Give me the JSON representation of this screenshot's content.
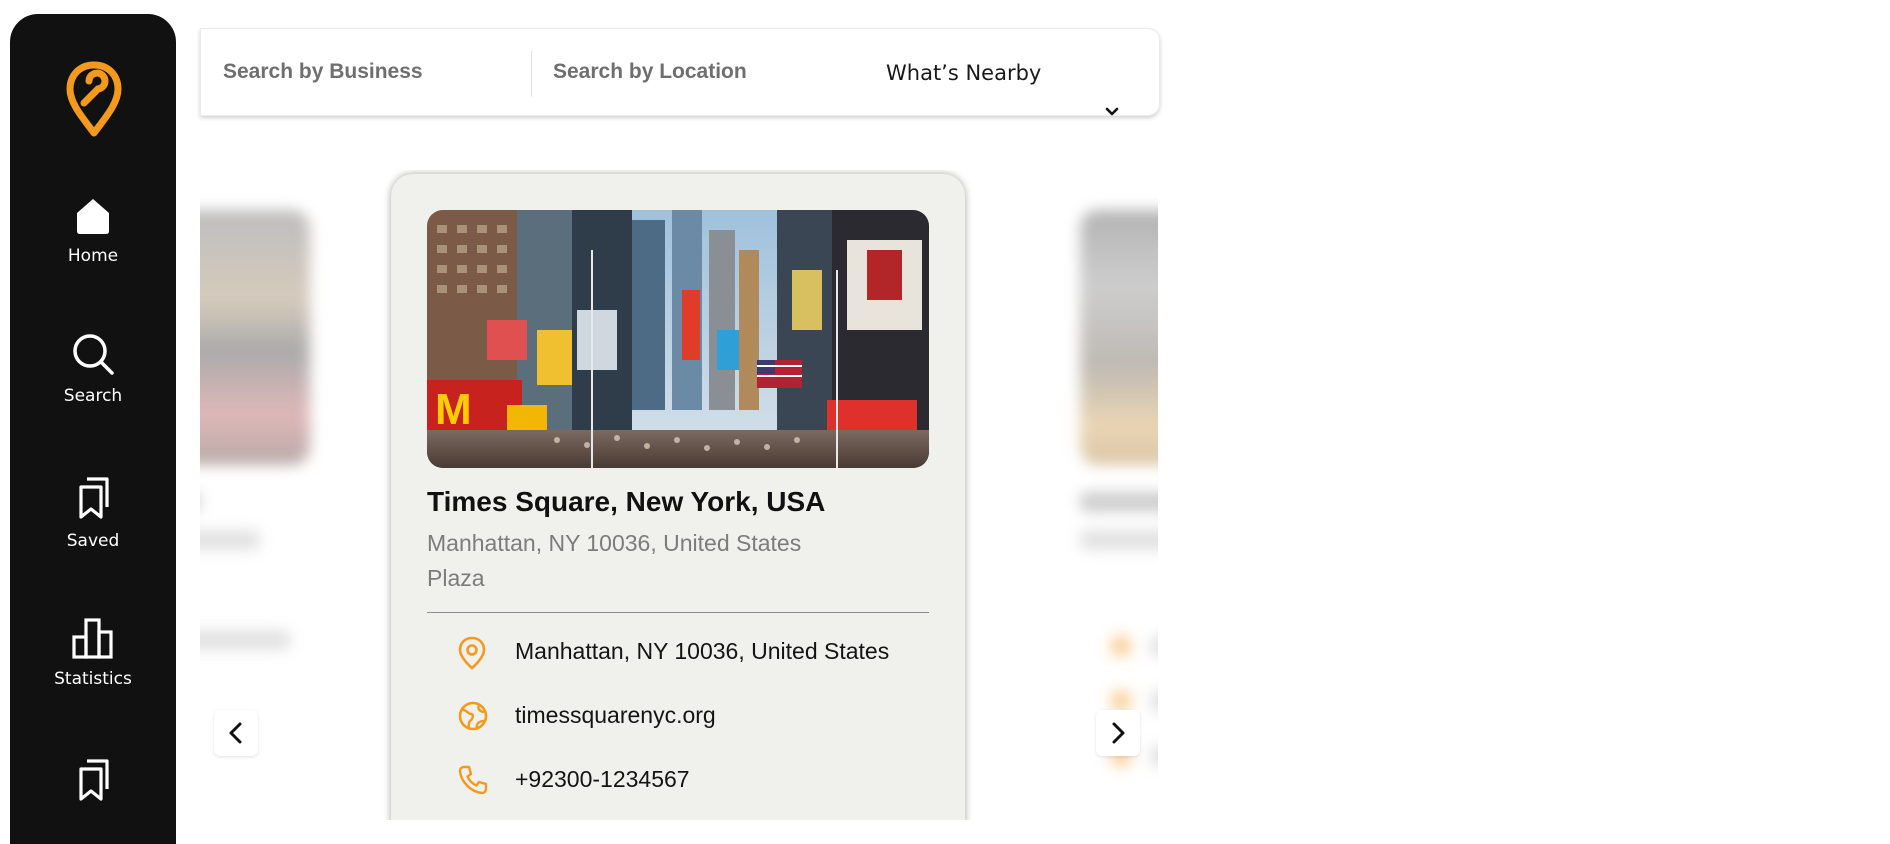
{
  "sidebar": {
    "logo_icon": "map-pin-logo",
    "items": [
      {
        "label": "Home",
        "icon": "home-icon"
      },
      {
        "label": "Search",
        "icon": "search-icon"
      },
      {
        "label": "Saved",
        "icon": "bookmark-icon"
      },
      {
        "label": "Statistics",
        "icon": "bar-chart-icon"
      },
      {
        "label": "",
        "icon": "bookmark-icon"
      }
    ]
  },
  "search": {
    "business_placeholder": "Search by Business",
    "location_placeholder": "Search by Location",
    "nearby_selected": "What’s Nearby"
  },
  "card": {
    "title": "Times Square, New York, USA",
    "subtitle": "Manhattan, NY 10036, United States Plaza",
    "address": "Manhattan, NY 10036, United States",
    "website": "timessquarenyc.org",
    "phone": "+92300-1234567",
    "image": "times-square-photo"
  },
  "colors": {
    "accent": "#f39a1e",
    "sidebar_bg": "#111111",
    "card_bg": "#f0f0ec"
  }
}
